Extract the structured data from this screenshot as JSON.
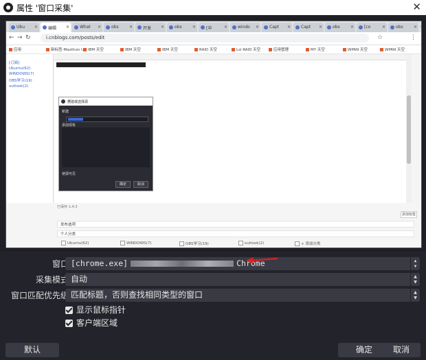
{
  "window": {
    "title": "属性 '窗口采集'"
  },
  "preview": {
    "browser": {
      "tabs": [
        "Ubu",
        "编辑",
        "What",
        "obs",
        "开发",
        "obs",
        "[中",
        "windo",
        "Capt",
        "Capt",
        "obs",
        "[co",
        "obs"
      ],
      "url": "i.cnblogs.com/posts/edit",
      "bookmarks": [
        "应用",
        "新标签-Maxthon I...",
        "IBM 天空",
        "IBM 天空",
        "IBM 天空",
        "RAID 天空",
        "Lsi RAID 天空",
        "应用管理",
        "MY 天空",
        "WPAN 天空",
        "WPAN 天空"
      ],
      "left_links": [
        "[订阅]",
        "Ubuntu(62)",
        "WINDOWS(7)",
        "OBS学习(19)",
        "outlook(2)"
      ],
      "dialog": {
        "title": "创建或选择源",
        "option_new": "新建",
        "option_existing": "添加现有",
        "visible": "使源可见",
        "ok": "确定",
        "cancel": "取消"
      },
      "lower": {
        "status": "已保存 1:4:3",
        "section_settings": "发布选项",
        "section_personal": "个人分类",
        "options": [
          "Ubuntu(62)",
          "WINDOWS(7)",
          "OBS学习(19)",
          "outlook(2)",
          "+ 添加分类"
        ],
        "section_advanced": "高级选项",
        "small_button": "添加标签"
      }
    }
  },
  "form": {
    "window_label": "窗口",
    "window_value_prefix": "[chrome.exe]",
    "window_value_suffix": "Chrome",
    "capture_mode_label": "采集模式",
    "capture_mode_value": "自动",
    "match_priority_label": "窗口匹配优先级",
    "match_priority_value": "匹配标题，否则查找相同类型的窗口",
    "show_cursor": "显示鼠标指针",
    "client_area": "客户端区域"
  },
  "buttons": {
    "defaults": "默认",
    "ok": "确定",
    "cancel": "取消"
  },
  "colors": {
    "background": "#23232b",
    "field": "#3a3a44",
    "accent_arrow": "#e02020"
  }
}
